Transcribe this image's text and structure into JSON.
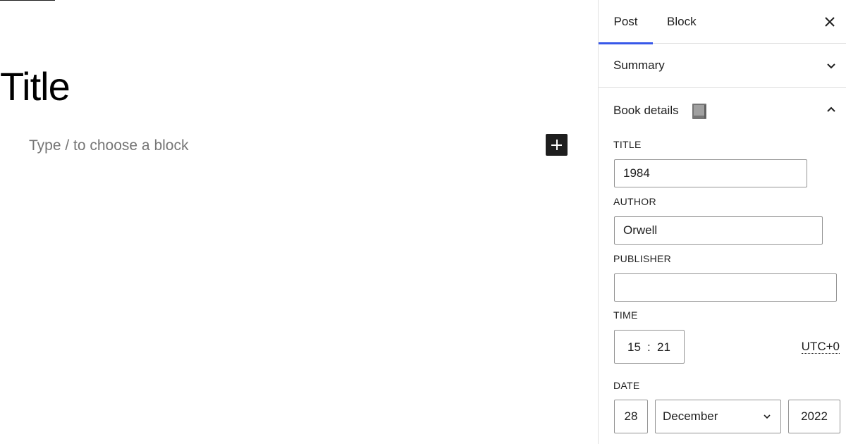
{
  "editor": {
    "post_title": "Title",
    "block_placeholder": "Type / to choose a block",
    "inserter_icon": "plus-icon"
  },
  "sidebar": {
    "tabs": [
      {
        "label": "Post",
        "active": true
      },
      {
        "label": "Block",
        "active": false
      }
    ],
    "close_icon": "close-icon",
    "summary_panel": {
      "title": "Summary",
      "expanded": false
    },
    "book_panel": {
      "title": "Book details",
      "icon": "book-icon",
      "expanded": true,
      "fields": {
        "title": {
          "label": "TITLE",
          "value": "1984"
        },
        "author": {
          "label": "AUTHOR",
          "value": "Orwell"
        },
        "publisher": {
          "label": "PUBLISHER",
          "value": ""
        },
        "time": {
          "label": "TIME",
          "hour": "15",
          "separator": ":",
          "minute": "21",
          "timezone": "UTC+0"
        },
        "date": {
          "label": "DATE",
          "day": "28",
          "month": "December",
          "year": "2022"
        }
      }
    }
  },
  "colors": {
    "accent": "#3858e9",
    "text": "#1e1e1e",
    "placeholder": "#757575",
    "border": "#949494",
    "divider": "#e0e0e0"
  }
}
